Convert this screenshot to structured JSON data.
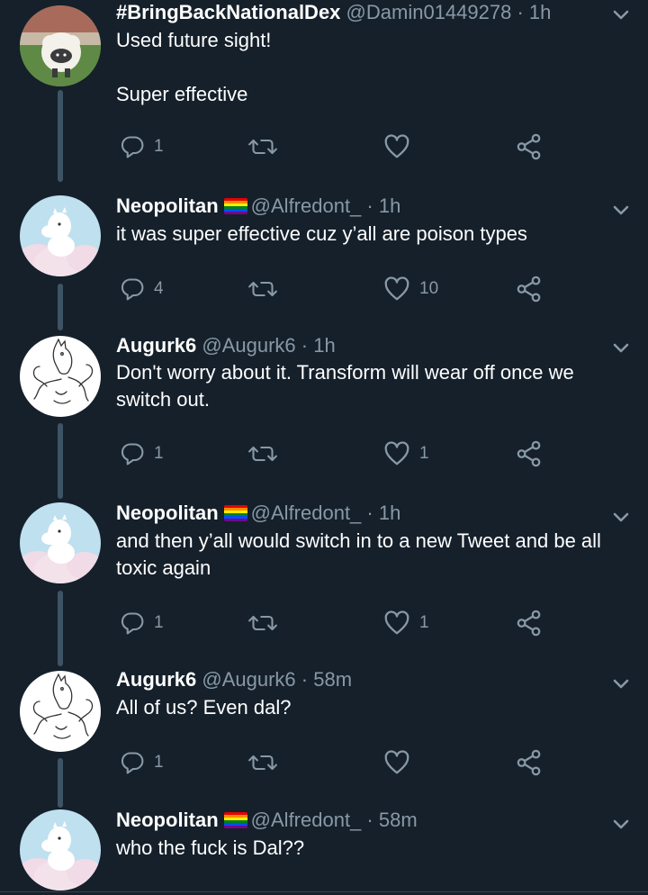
{
  "colors": {
    "background": "#15202b",
    "text": "#ffffff",
    "muted": "#8899a6",
    "thread_line": "#3d5466"
  },
  "icons": {
    "reply": "reply-icon",
    "retweet": "retweet-icon",
    "like": "heart-icon",
    "share": "share-icon",
    "menu": "chevron-down-icon",
    "flag": "rainbow-flag-icon"
  },
  "tweets": [
    {
      "name": "#BringBackNationalDex",
      "handle": "@Damin01449278",
      "time": "1h",
      "text": "Used future sight!\n\nSuper effective",
      "replies": "1",
      "likes": ""
    },
    {
      "name": "Neopolitan",
      "handle": "@Alfredont_",
      "time": "1h",
      "text": "it was super effective cuz y’all are poison types",
      "replies": "4",
      "likes": "10"
    },
    {
      "name": "Augurk6",
      "handle": "@Augurk6",
      "time": "1h",
      "text": "Don't worry about it. Transform will wear off once we switch out.",
      "replies": "1",
      "likes": "1"
    },
    {
      "name": "Neopolitan",
      "handle": "@Alfredont_",
      "time": "1h",
      "text": "and then y’all would switch in to a new Tweet and be all toxic again",
      "replies": "1",
      "likes": "1"
    },
    {
      "name": "Augurk6",
      "handle": "@Augurk6",
      "time": "58m",
      "text": "All of us? Even dal?",
      "replies": "1",
      "likes": ""
    },
    {
      "name": "Neopolitan",
      "handle": "@Alfredont_",
      "time": "58m",
      "text": "who the fuck is Dal??"
    }
  ],
  "separator": " · "
}
